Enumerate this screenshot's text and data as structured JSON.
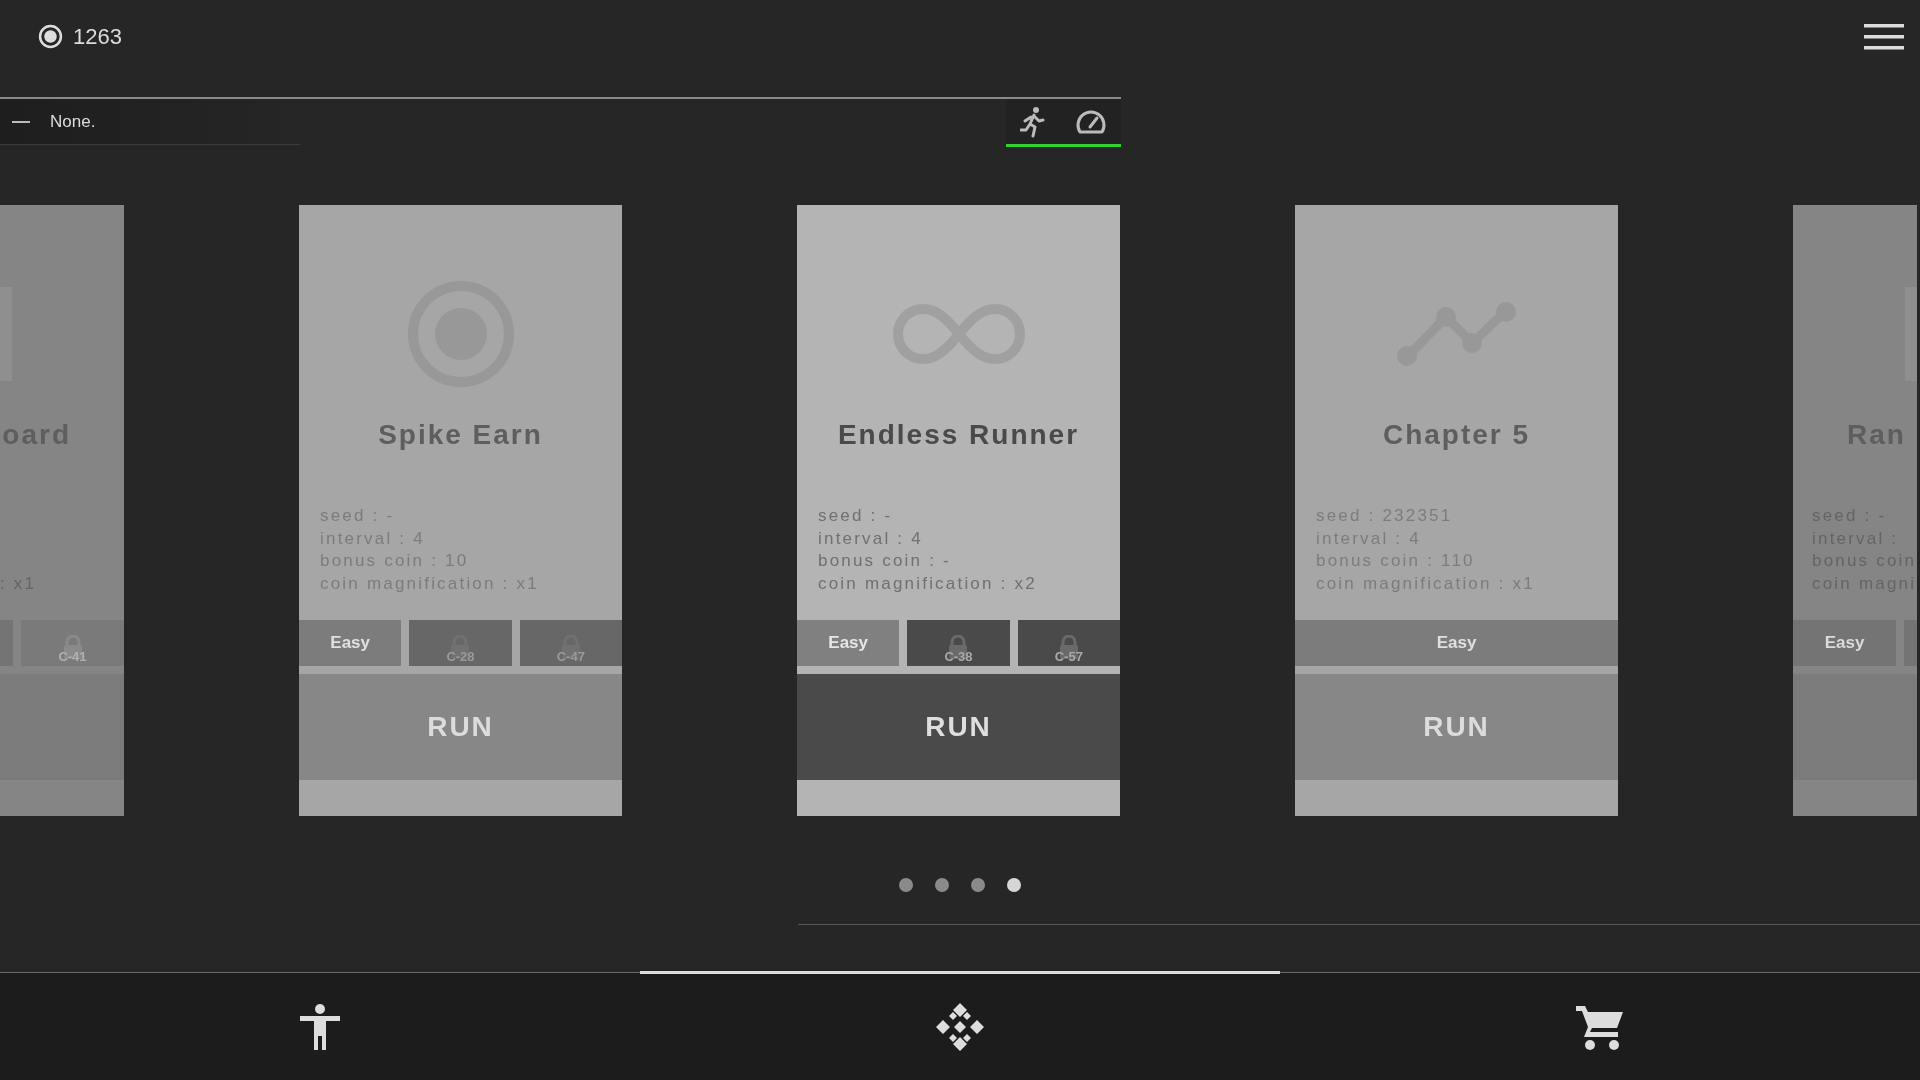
{
  "currency": {
    "amount": "1263"
  },
  "filter": {
    "text": "None."
  },
  "mode_switch": {
    "on": true
  },
  "cards": [
    {
      "kind": "edge_left",
      "emblem": {
        "kind": "tile"
      },
      "title": "oard",
      "details": [
        ": x1"
      ],
      "difficulties": [
        {
          "locked": false
        },
        {
          "label": "C-41",
          "locked": true
        }
      ]
    },
    {
      "kind": "full",
      "selected": false,
      "emblem": {
        "kind": "target"
      },
      "title": "Spike Earn",
      "details": [
        "seed : -",
        "interval : 4",
        "bonus coin : 10",
        "coin magnification : x1"
      ],
      "difficulties": [
        {
          "label": "Easy",
          "locked": false
        },
        {
          "label": "C-28",
          "locked": true
        },
        {
          "label": "C-47",
          "locked": true
        }
      ],
      "run": "RUN"
    },
    {
      "kind": "full",
      "selected": true,
      "emblem": {
        "kind": "infinity"
      },
      "title": "Endless Runner",
      "details": [
        "seed : -",
        "interval : 4",
        "bonus coin : -",
        "coin magnification : x2"
      ],
      "difficulties": [
        {
          "label": "Easy",
          "locked": false
        },
        {
          "label": "C-38",
          "locked": true
        },
        {
          "label": "C-57",
          "locked": true
        }
      ],
      "run": "RUN"
    },
    {
      "kind": "full",
      "selected": false,
      "emblem": {
        "kind": "path"
      },
      "title": "Chapter 5",
      "details": [
        "seed : 232351",
        "interval : 4",
        "bonus coin : 110",
        "coin magnification : x1"
      ],
      "difficulties": [
        {
          "label": "Easy",
          "locked": false
        }
      ],
      "run": "RUN"
    },
    {
      "kind": "edge_right",
      "emblem": {
        "kind": "tile"
      },
      "title": "Ran",
      "details": [
        "seed : -",
        "interval :",
        "bonus coin",
        "coin magni"
      ],
      "difficulties": [
        {
          "label": "Easy",
          "locked": false
        },
        {
          "locked": false
        }
      ]
    }
  ],
  "pages": [
    {
      "selected": false
    },
    {
      "selected": false
    },
    {
      "selected": false
    },
    {
      "selected": true
    }
  ],
  "nav": [
    {
      "kind": "figure",
      "selected": false
    },
    {
      "kind": "diamond",
      "selected": true
    },
    {
      "kind": "cart",
      "selected": false
    }
  ]
}
